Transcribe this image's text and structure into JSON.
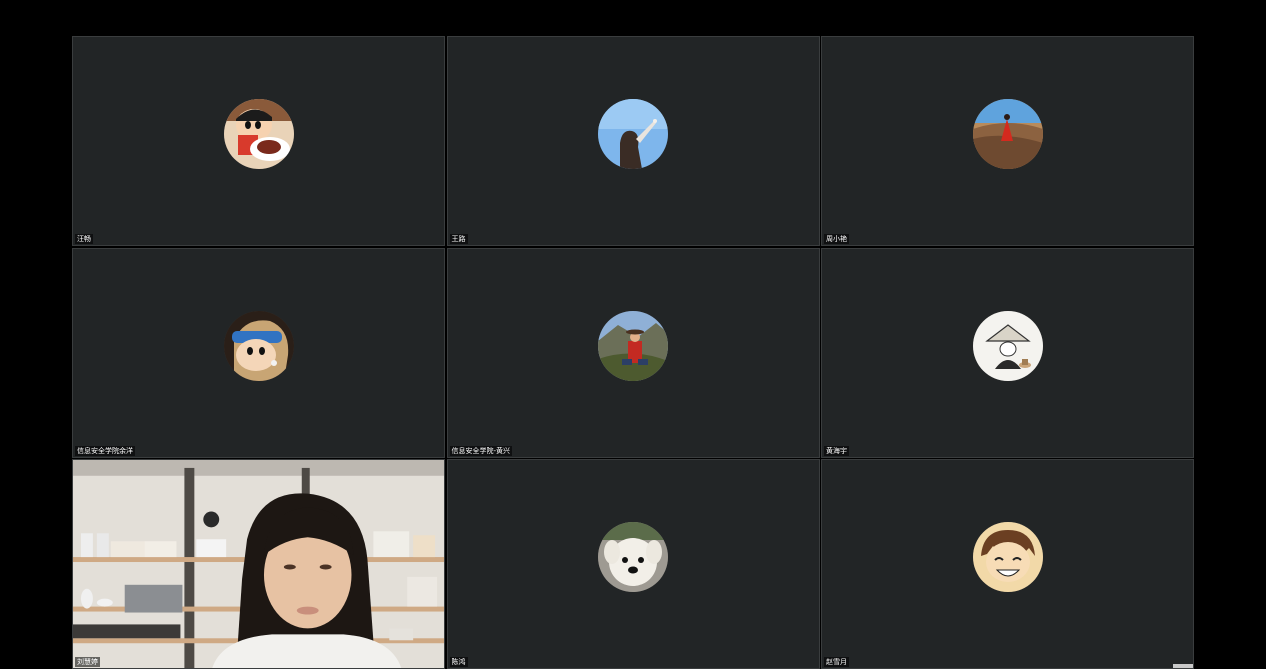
{
  "window": {
    "title": ""
  },
  "gallery": {
    "participants": [
      {
        "name": "汪畅",
        "avatar_icon": "crayon-shin-chan-eating-avatar"
      },
      {
        "name": "王路",
        "avatar_icon": "woman-sky-avatar"
      },
      {
        "name": "周小艳",
        "avatar_icon": "desert-red-dress-avatar"
      },
      {
        "name": "信息安全学院余洋",
        "avatar_icon": "crayon-shin-chan-pearl-earring-avatar"
      },
      {
        "name": "信息安全学院-黄兴",
        "avatar_icon": "man-red-shirt-hills-avatar"
      },
      {
        "name": "黄海宇",
        "avatar_icon": "monk-ink-painting-avatar"
      },
      {
        "name": "刘慧婷",
        "avatar_icon": "live-camera-video",
        "video_on": true
      },
      {
        "name": "陈鸿",
        "avatar_icon": "white-dog-avatar"
      },
      {
        "name": "赵雪月",
        "avatar_icon": "anime-boy-smile-avatar"
      }
    ]
  },
  "colors": {
    "tile_bg": "#222526",
    "page_bg": "#000000",
    "tile_border": "#3a3d3e"
  }
}
